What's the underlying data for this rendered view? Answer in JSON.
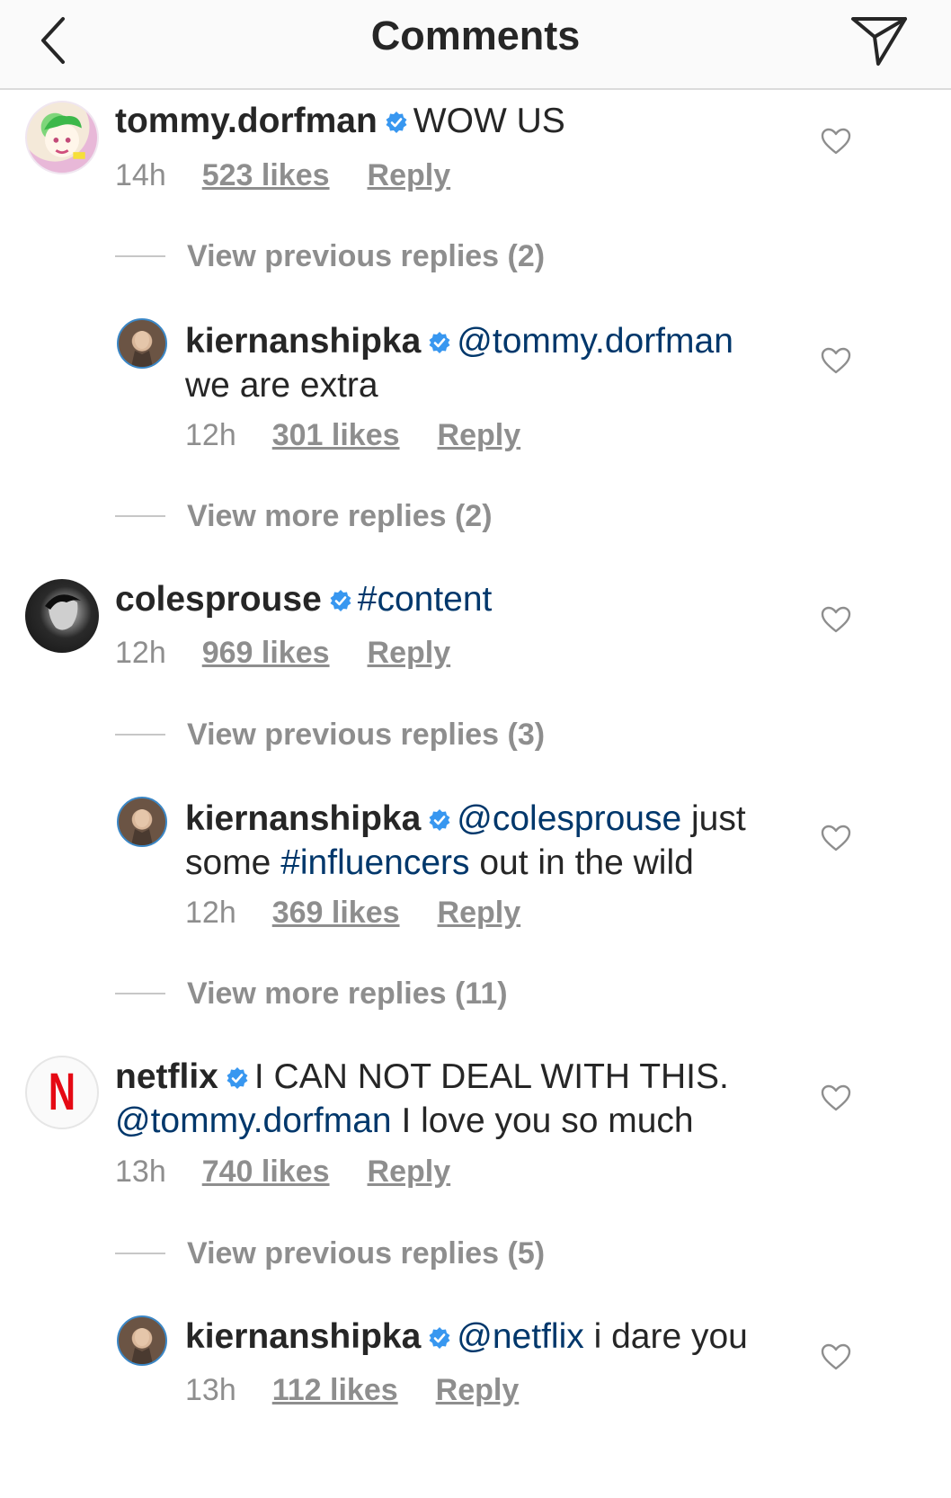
{
  "header": {
    "title": "Comments"
  },
  "colors": {
    "link": "#00376b",
    "muted": "#8e8e8e",
    "verified": "#3897f0"
  },
  "comments": [
    {
      "username": "tommy.dorfman",
      "text": "WOW US",
      "time": "14h",
      "likes": "523 likes",
      "reply": "Reply",
      "view_replies": "View previous replies (2)",
      "replies": [
        {
          "username": "kiernanshipka",
          "mention": "@tommy.dorfman",
          "text_line2": "we are extra",
          "time": "12h",
          "likes": "301 likes",
          "reply": "Reply",
          "view_more": "View more replies (2)"
        }
      ]
    },
    {
      "username": "colesprouse",
      "hashtag": "#content",
      "time": "12h",
      "likes": "969 likes",
      "reply": "Reply",
      "view_replies": "View previous replies (3)",
      "replies": [
        {
          "username": "kiernanshipka",
          "mention": "@colesprouse",
          "text_after_mention": " just",
          "text_line2_before": "some ",
          "hashtag": "#influencers",
          "text_line2_after": " out in the wild",
          "time": "12h",
          "likes": "369 likes",
          "reply": "Reply",
          "view_more": "View more replies (11)"
        }
      ]
    },
    {
      "username": "netflix",
      "text": "I CAN NOT DEAL WITH THIS.",
      "mention": "@tommy.dorfman",
      "text_after_mention": " I love you so much",
      "time": "13h",
      "likes": "740 likes",
      "reply": "Reply",
      "view_replies": "View previous replies (5)",
      "replies": [
        {
          "username": "kiernanshipka",
          "mention": "@netflix",
          "text_after_mention": " i dare you",
          "time": "13h",
          "likes": "112 likes",
          "reply": "Reply"
        }
      ]
    }
  ],
  "avatar_letters": {
    "netflix": "N"
  }
}
